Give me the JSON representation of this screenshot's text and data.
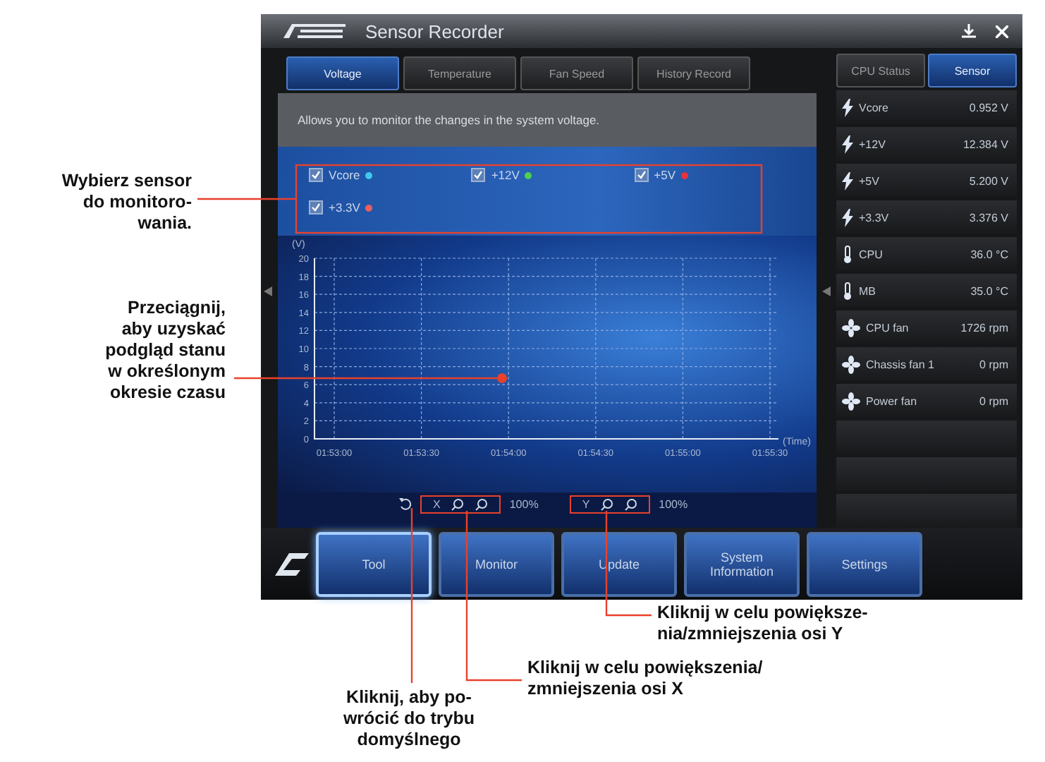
{
  "window": {
    "title": "Sensor Recorder"
  },
  "tabs": [
    {
      "label": "Voltage",
      "selected": true
    },
    {
      "label": "Temperature",
      "selected": false
    },
    {
      "label": "Fan Speed",
      "selected": false
    },
    {
      "label": "History Record",
      "selected": false
    }
  ],
  "description": "Allows you to monitor the changes in the system voltage.",
  "sensors": [
    {
      "label": "Vcore",
      "checked": true,
      "color": "#3fc8f0"
    },
    {
      "label": "+12V",
      "checked": true,
      "color": "#4ed04e"
    },
    {
      "label": "+5V",
      "checked": true,
      "color": "#e8323c"
    },
    {
      "label": "+3.3V",
      "checked": true,
      "color": "#e86060"
    }
  ],
  "chart": {
    "chart_data": {
      "type": "line",
      "grid": true,
      "ylabel": "(V)",
      "xlabel": "(Time)",
      "categories": [
        "01:53:00",
        "01:53:30",
        "01:54:00",
        "01:54:30",
        "01:55:00",
        "01:55:30"
      ],
      "ylim": [
        0,
        20
      ],
      "yticks": [
        0,
        2,
        4,
        6,
        8,
        10,
        12,
        14,
        16,
        18,
        20
      ]
    }
  },
  "zoom": {
    "x_label": "X",
    "x_value": "100%",
    "y_label": "Y",
    "y_value": "100%"
  },
  "side_tabs": [
    {
      "label": "CPU Status",
      "selected": false
    },
    {
      "label": "Sensor",
      "selected": true
    }
  ],
  "readings": [
    {
      "kind": "voltage",
      "name": "Vcore",
      "value": "0.952 V"
    },
    {
      "kind": "voltage",
      "name": "+12V",
      "value": "12.384 V"
    },
    {
      "kind": "voltage",
      "name": "+5V",
      "value": "5.200 V"
    },
    {
      "kind": "voltage",
      "name": "+3.3V",
      "value": "3.376 V"
    },
    {
      "kind": "temperature",
      "name": "CPU",
      "value": "36.0 °C"
    },
    {
      "kind": "temperature",
      "name": "MB",
      "value": "35.0 °C"
    },
    {
      "kind": "fan",
      "name": "CPU fan",
      "value": "1726 rpm"
    },
    {
      "kind": "fan",
      "name": "Chassis fan 1",
      "value": "0 rpm"
    },
    {
      "kind": "fan",
      "name": "Power fan",
      "value": "0 rpm"
    }
  ],
  "menu": [
    {
      "label": "Tool",
      "selected": true
    },
    {
      "label": "Monitor",
      "selected": false
    },
    {
      "label": "Update",
      "selected": false
    },
    {
      "label": "System Information",
      "selected": false
    },
    {
      "label": "Settings",
      "selected": false
    }
  ],
  "callouts": [
    {
      "text": "Wybierz sensor\ndo monitoro-\nwania."
    },
    {
      "text": "Przeciągnij,\naby uzyskać\npodgląd stanu\nw określonym\nokresie czasu"
    },
    {
      "text": "Kliknij w celu powiększe-\nnia/zmniejszenia osi Y"
    },
    {
      "text": "Kliknij w celu powiększenia/\nzmniejszenia osi X"
    },
    {
      "text": "Kliknij, aby po-\nwrócić do trybu\ndomyślnego"
    }
  ]
}
